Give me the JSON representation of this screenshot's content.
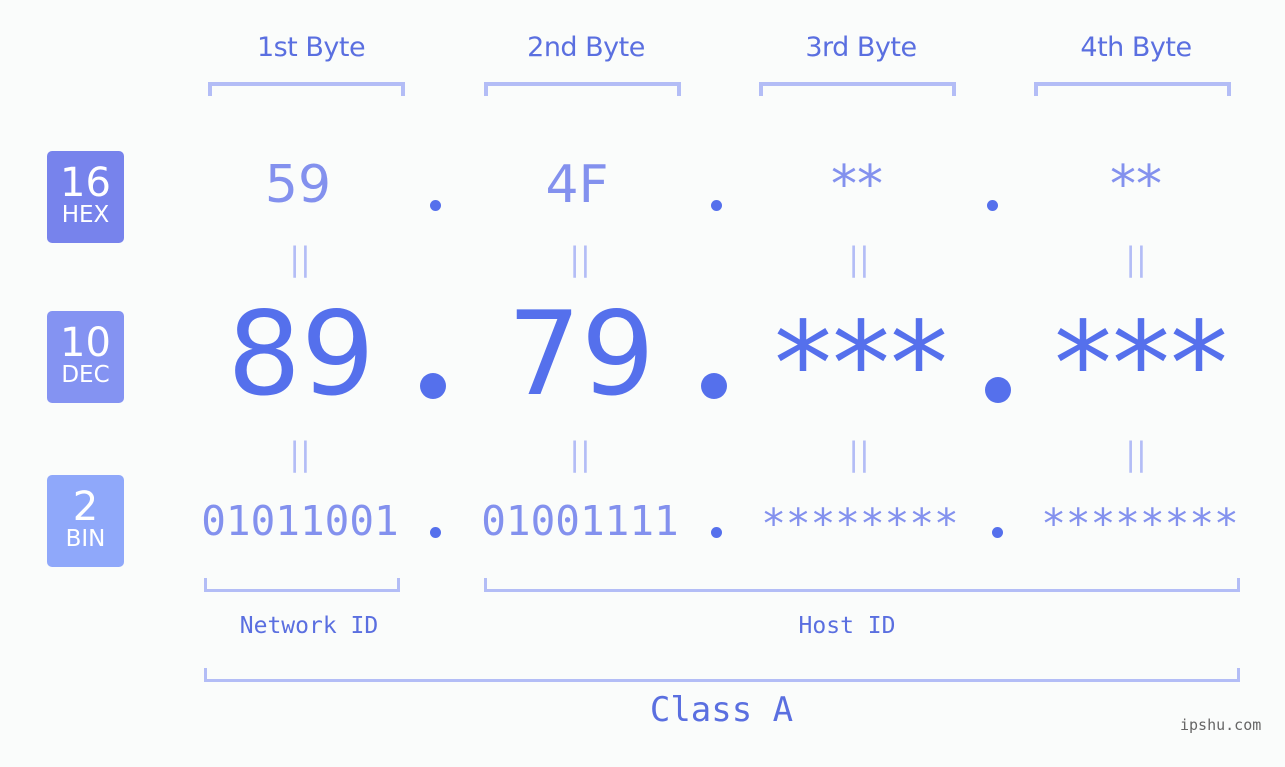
{
  "byte_headers": [
    "1st Byte",
    "2nd Byte",
    "3rd Byte",
    "4th Byte"
  ],
  "badges": {
    "hex": {
      "number": "16",
      "label": "HEX",
      "color": "#7783ec"
    },
    "dec": {
      "number": "10",
      "label": "DEC",
      "color": "#8493f2"
    },
    "bin": {
      "number": "2",
      "label": "BIN",
      "color": "#8fa8fa"
    }
  },
  "hex": [
    "59",
    "4F",
    "**",
    "**"
  ],
  "dec": [
    "89",
    "79",
    "***",
    "***"
  ],
  "bin": [
    "01011001",
    "01001111",
    "********",
    "********"
  ],
  "equals_symbol": "||",
  "network_id_label": "Network ID",
  "host_id_label": "Host ID",
  "class_label": "Class A",
  "watermark": "ipshu.com",
  "colors": {
    "accent": "#5570ec",
    "light_accent": "#8391ee",
    "bracket": "#b3bdf6",
    "background": "#fafcfb"
  }
}
